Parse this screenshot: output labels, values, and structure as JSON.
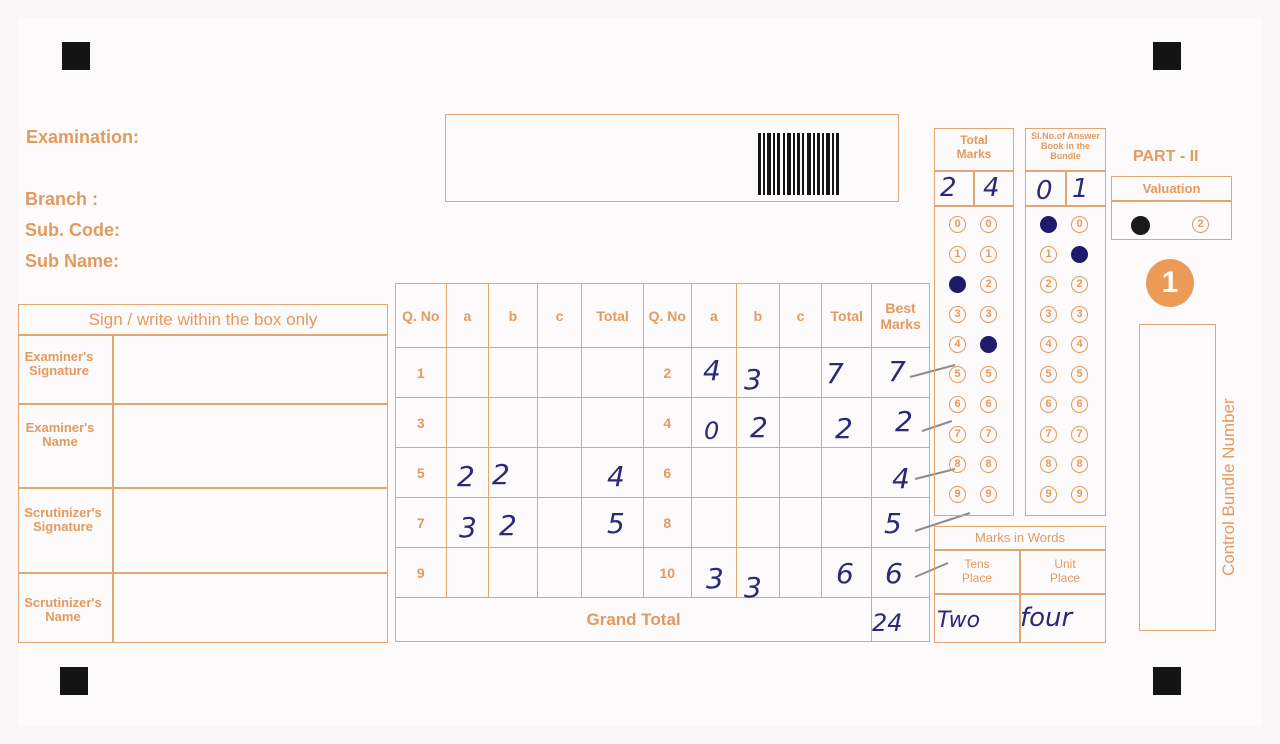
{
  "header": {
    "examination_label": "Examination:",
    "branch_label": "Branch :",
    "sub_code_label": "Sub. Code:",
    "sub_name_label": "Sub Name:",
    "part_label": "PART - II",
    "valuation_label": "Valuation",
    "valuation_options": [
      "1",
      "2"
    ],
    "valuation_selected": "1",
    "big_number": "1",
    "control_bundle_label": "Control Bundle Number"
  },
  "sign_box": {
    "title": "Sign / write within the box only",
    "rows": [
      "Examiner's Signature",
      "Examiner's Name",
      "Scrutinizer's Signature",
      "Scrutinizer's Name"
    ]
  },
  "marks_table": {
    "headers": [
      "Q. No",
      "a",
      "b",
      "c",
      "Total",
      "Q. No",
      "a",
      "b",
      "c",
      "Total",
      "Best Marks"
    ],
    "rows": [
      {
        "q1": "1",
        "a1": "",
        "b1": "",
        "c1": "",
        "t1": "",
        "q2": "2",
        "a2": "4",
        "b2": "3",
        "c2": "",
        "t2": "7",
        "best": "7"
      },
      {
        "q1": "3",
        "a1": "",
        "b1": "",
        "c1": "",
        "t1": "",
        "q2": "4",
        "a2": "0",
        "b2": "2",
        "c2": "",
        "t2": "2",
        "best": "2"
      },
      {
        "q1": "5",
        "a1": "2",
        "b1": "2",
        "c1": "",
        "t1": "4",
        "q2": "6",
        "a2": "",
        "b2": "",
        "c2": "",
        "t2": "",
        "best": "4"
      },
      {
        "q1": "7",
        "a1": "3",
        "b1": "2",
        "c1": "",
        "t1": "5",
        "q2": "8",
        "a2": "",
        "b2": "",
        "c2": "",
        "t2": "",
        "best": "5"
      },
      {
        "q1": "9",
        "a1": "",
        "b1": "",
        "c1": "",
        "t1": "",
        "q2": "10",
        "a2": "3",
        "b2": "3",
        "c2": "",
        "t2": "6",
        "best": "6"
      }
    ],
    "grand_total_label": "Grand Total",
    "grand_total_value": "24"
  },
  "total_marks": {
    "label": "Total Marks",
    "digits": [
      "2",
      "4"
    ],
    "bubbles": [
      "0",
      "1",
      "2",
      "3",
      "4",
      "5",
      "6",
      "7",
      "8",
      "9"
    ],
    "filled": [
      2,
      4
    ]
  },
  "answer_book": {
    "label": "Sl.No.of Answer Book in the Bundle",
    "digits": [
      "0",
      "1"
    ],
    "bubbles": [
      "0",
      "1",
      "2",
      "3",
      "4",
      "5",
      "6",
      "7",
      "8",
      "9"
    ],
    "filled": [
      0,
      1
    ]
  },
  "marks_in_words": {
    "label": "Marks in Words",
    "tens_label": "Tens Place",
    "unit_label": "Unit Place",
    "tens_value": "Two",
    "unit_value": "four"
  }
}
